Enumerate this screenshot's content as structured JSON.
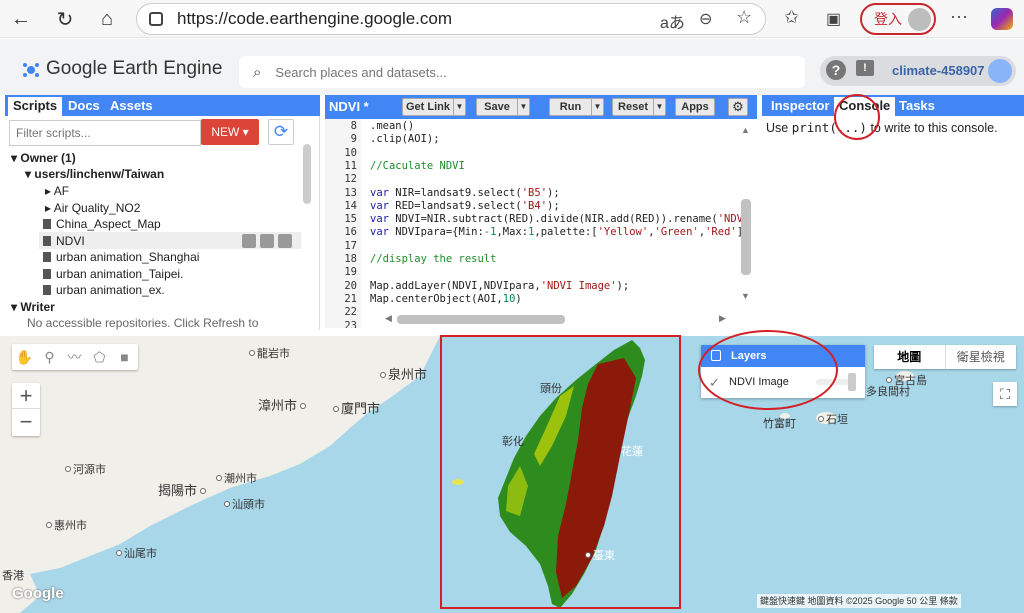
{
  "browser": {
    "url": "https://code.earthengine.google.com",
    "translate_icon": "aあ",
    "signin_label": "登入",
    "icons": [
      "back-arrow-icon",
      "reload-icon",
      "home-icon",
      "lock-icon",
      "translate-icon",
      "zoom-icon",
      "star-icon",
      "favorites-icon",
      "collections-icon",
      "profile-icon",
      "more-icon",
      "copilot-icon"
    ]
  },
  "header": {
    "app_title": "Google Earth Engine",
    "search_placeholder": "Search places and datasets...",
    "help_label": "?",
    "feedback_label": "!",
    "project": "climate-458907"
  },
  "left_panel": {
    "tabs": [
      {
        "label": "Scripts",
        "active": true
      },
      {
        "label": "Docs",
        "active": false
      },
      {
        "label": "Assets",
        "active": false
      }
    ],
    "filter_placeholder": "Filter scripts...",
    "new_button": "NEW",
    "tree": {
      "owner": "Owner (1)",
      "repo": "users/linchenw/Taiwan",
      "folders": [
        "AF",
        "Air Quality_NO2"
      ],
      "files": [
        "China_Aspect_Map",
        "NDVI",
        "urban animation_Shanghai",
        "urban animation_Taipei.",
        "urban animation_ex."
      ],
      "selected_file": "NDVI",
      "writer": "Writer",
      "writer_note": "No accessible repositories. Click Refresh to"
    }
  },
  "editor": {
    "title": "NDVI *",
    "buttons": {
      "get_link": "Get Link",
      "save": "Save",
      "run": "Run",
      "reset": "Reset",
      "apps": "Apps"
    },
    "lines": [
      {
        "n": "8",
        "code": ".mean()"
      },
      {
        "n": "9",
        "code": ".clip(AOI);"
      },
      {
        "n": "10",
        "code": ""
      },
      {
        "n": "11",
        "code": "//Caculate NDVI"
      },
      {
        "n": "12",
        "code": ""
      },
      {
        "n": "13",
        "code": "var NIR=landsat9.select('B5');"
      },
      {
        "n": "14",
        "code": "var RED=landsat9.select('B4');"
      },
      {
        "n": "15",
        "code": "var NDVI=NIR.subtract(RED).divide(NIR.add(RED)).rename('NDV"
      },
      {
        "n": "16",
        "code": "var NDVIpara={Min:-1,Max:1,palette:['Yellow','Green','Red']"
      },
      {
        "n": "17",
        "code": ""
      },
      {
        "n": "18",
        "code": "//display the result"
      },
      {
        "n": "19",
        "code": ""
      },
      {
        "n": "20",
        "code": "Map.addLayer(NDVI,NDVIpara,'NDVI Image');"
      },
      {
        "n": "21",
        "code": "Map.centerObject(AOI,10)"
      },
      {
        "n": "22",
        "code": ""
      },
      {
        "n": "23",
        "code": ""
      }
    ]
  },
  "right_panel": {
    "tabs": [
      {
        "label": "Inspector",
        "active": false
      },
      {
        "label": "Console",
        "active": true
      },
      {
        "label": "Tasks",
        "active": false
      }
    ],
    "console_pre": "Use ",
    "console_code": "print(...)",
    "console_post": " to write to this console."
  },
  "map": {
    "tool_icons": [
      "hand-icon",
      "marker-icon",
      "line-icon",
      "polygon-icon",
      "rectangle-icon"
    ],
    "zoom_in": "+",
    "zoom_out": "−",
    "layers_title": "Layers",
    "layer_name": "NDVI Image",
    "map_types": [
      "地圖",
      "衛星檢視"
    ],
    "labels": [
      "龍岩市",
      "泉州市",
      "漳州市",
      "廈門市",
      "河源市",
      "潮州市",
      "揭陽市",
      "汕頭市",
      "惠州市",
      "汕尾市",
      "香港",
      "宮古島",
      "多良間村",
      "竹富町",
      "石垣",
      "頭份",
      "彰化",
      "花蓮",
      "臺東"
    ],
    "attribution": "鍵盤快速鍵   地圖資料 ©2025 Google   50 公里          條款",
    "google_logo": "Google",
    "ndvi_palette": [
      "#e8e800",
      "#2e8b1e",
      "#8b1a0a"
    ]
  }
}
